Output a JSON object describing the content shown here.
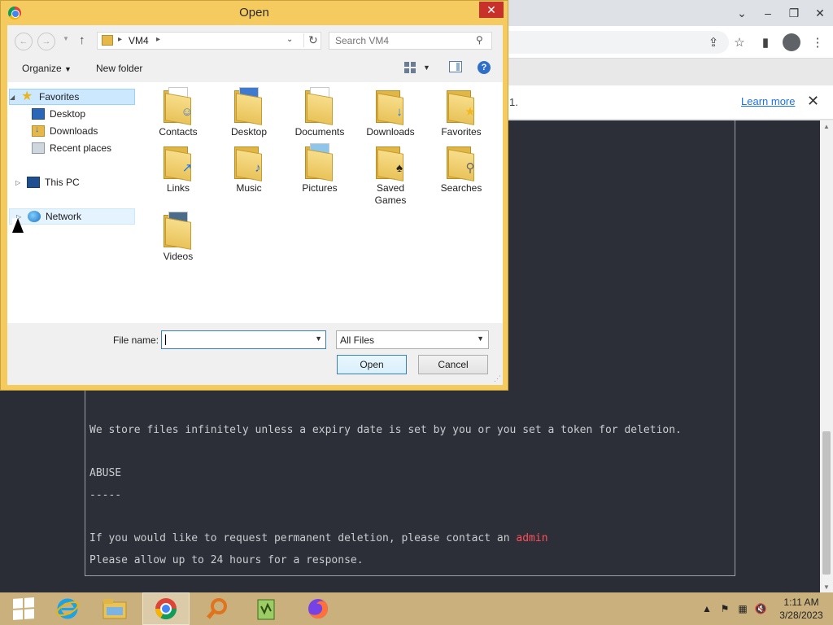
{
  "browser": {
    "infobar": {
      "text": "1.",
      "learn_more": "Learn more"
    },
    "page_lines": [
      "We store files infinitely unless a expiry date is set by you or you set a token for deletion.",
      "",
      "ABUSE",
      "-----",
      "",
      "If you would like to request permanent deletion, please contact an ",
      "Please allow up to 24 hours for a response."
    ],
    "admin_link": "admin"
  },
  "dialog": {
    "title": "Open",
    "address": "VM4",
    "search_placeholder": "Search VM4",
    "organize": "Organize",
    "new_folder": "New folder",
    "nav_items": [
      {
        "label": "Favorites",
        "icon": "star-icon"
      },
      {
        "label": "Desktop",
        "icon": "desktop-icon"
      },
      {
        "label": "Downloads",
        "icon": "downloads-icon"
      },
      {
        "label": "Recent places",
        "icon": "recent-places-icon"
      },
      {
        "label": "This PC",
        "icon": "computer-icon"
      },
      {
        "label": "Network",
        "icon": "network-icon"
      }
    ],
    "files": [
      {
        "label": "Contacts",
        "icon": "contacts-folder-icon"
      },
      {
        "label": "Desktop",
        "icon": "desktop-folder-icon"
      },
      {
        "label": "Documents",
        "icon": "documents-folder-icon"
      },
      {
        "label": "Downloads",
        "icon": "downloads-folder-icon"
      },
      {
        "label": "Favorites",
        "icon": "favorites-folder-icon"
      },
      {
        "label": "Links",
        "icon": "links-folder-icon"
      },
      {
        "label": "Music",
        "icon": "music-folder-icon"
      },
      {
        "label": "Pictures",
        "icon": "pictures-folder-icon"
      },
      {
        "label": "Saved Games",
        "icon": "saved-games-folder-icon"
      },
      {
        "label": "Searches",
        "icon": "searches-folder-icon"
      },
      {
        "label": "Videos",
        "icon": "videos-folder-icon"
      }
    ],
    "file_name_label": "File name:",
    "file_name_value": "",
    "file_type": "All Files",
    "open_button": "Open",
    "cancel_button": "Cancel"
  },
  "taskbar": {
    "time": "1:11 AM",
    "date": "3/28/2023"
  }
}
